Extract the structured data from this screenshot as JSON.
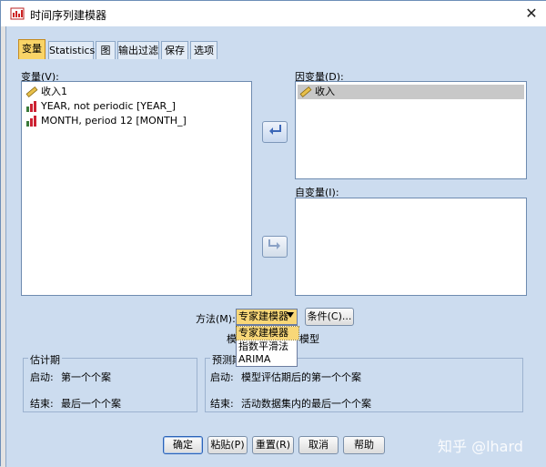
{
  "window": {
    "title": "时间序列建模器",
    "close_glyph": "✕"
  },
  "tabs": [
    {
      "label": "变量",
      "active": true
    },
    {
      "label": "Statistics",
      "active": false
    },
    {
      "label": "图",
      "active": false
    },
    {
      "label": "输出过滤",
      "active": false
    },
    {
      "label": "保存",
      "active": false
    },
    {
      "label": "选项",
      "active": false
    }
  ],
  "variables": {
    "label": "变量(V):",
    "items": [
      {
        "label": "收入1",
        "icon": "ruler-icon"
      },
      {
        "label": "YEAR, not periodic [YEAR_]",
        "icon": "bar-chart-icon"
      },
      {
        "label": "MONTH, period 12 [MONTH_]",
        "icon": "bar-chart-icon"
      }
    ]
  },
  "dependent": {
    "label": "因变量(D):",
    "items": [
      {
        "label": "收入",
        "icon": "ruler-icon",
        "selected": true
      }
    ]
  },
  "independent": {
    "label": "自变量(I):",
    "items": []
  },
  "method": {
    "label": "方法(M):",
    "selected": "专家建模器",
    "options": [
      "专家建模器",
      "指数平滑法",
      "ARIMA"
    ],
    "conditions_button": "条件(C)...",
    "behind_left": "模",
    "behind_right": "模型"
  },
  "estimation": {
    "title": "估计期",
    "start_label": "启动:",
    "start_value": "第一个个案",
    "end_label": "结束:",
    "end_value": "最后一个个案"
  },
  "forecast": {
    "title": "预测期",
    "start_label": "启动:",
    "start_value": "模型评估期后的第一个个案",
    "end_label": "结束:",
    "end_value": "活动数据集内的最后一个个案"
  },
  "buttons": {
    "ok": "确定",
    "paste": "粘贴(P)",
    "reset": "重置(R)",
    "cancel": "取消",
    "help": "帮助"
  },
  "watermark": "知乎 @lhard",
  "colors": {
    "active_tab": "#f9d467",
    "selection": "#c8c8c8",
    "accent": "#2c56a6"
  }
}
